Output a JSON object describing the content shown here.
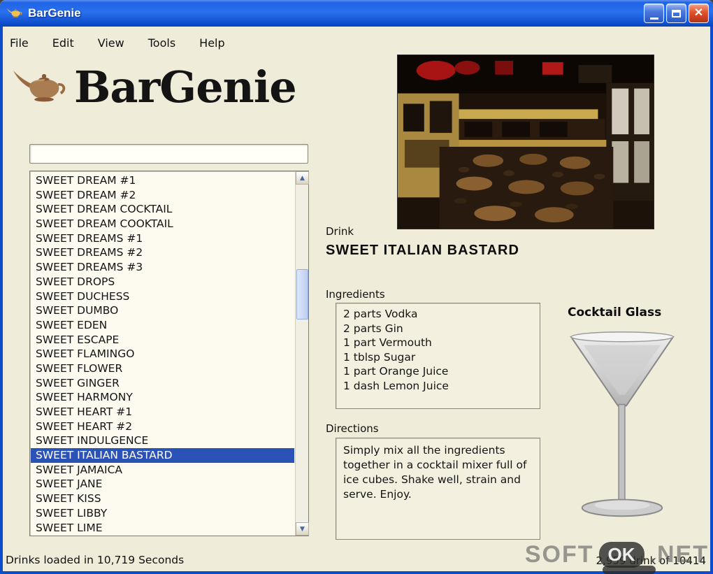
{
  "window": {
    "title": "BarGenie"
  },
  "menu": {
    "items": [
      "File",
      "Edit",
      "View",
      "Tools",
      "Help"
    ]
  },
  "logo": {
    "text": "BarGenie"
  },
  "search": {
    "value": ""
  },
  "drink_list": {
    "items": [
      "SWEET DREAM #1",
      "SWEET DREAM #2",
      "SWEET DREAM COCKTAIL",
      "SWEET DREAM COOKTAIL",
      "SWEET DREAMS #1",
      "SWEET DREAMS #2",
      "SWEET DREAMS #3",
      "SWEET DROPS",
      "SWEET DUCHESS",
      "SWEET DUMBO",
      "SWEET EDEN",
      "SWEET ESCAPE",
      "SWEET FLAMINGO",
      "SWEET FLOWER",
      "SWEET GINGER",
      "SWEET HARMONY",
      "SWEET HEART #1",
      "SWEET HEART #2",
      "SWEET INDULGENCE",
      "SWEET ITALIAN BASTARD",
      "SWEET JAMAICA",
      "SWEET JANE",
      "SWEET KISS",
      "SWEET LIBBY",
      "SWEET LIME"
    ],
    "selected": "SWEET ITALIAN BASTARD"
  },
  "detail": {
    "drink_label": "Drink",
    "drink_name": "SWEET ITALIAN BASTARD",
    "ingredients_label": "Ingredients",
    "ingredients": [
      "2 parts Vodka",
      "2 parts Gin",
      "1 part Vermouth",
      "1 tblsp Sugar",
      "1 part Orange Juice",
      "1 dash Lemon Juice"
    ],
    "glass_label": "Cocktail Glass",
    "directions_label": "Directions",
    "directions": "Simply mix all the ingredients together in a cocktail mixer full of ice cubes.  Shake well, strain and serve.  Enjoy."
  },
  "status": {
    "left": "Drinks loaded in 10,719 Seconds",
    "right": "2,959 drink of 10414"
  },
  "watermark": {
    "prefix": "SOFT",
    "badge": "OK",
    "suffix": ".NET"
  },
  "colors": {
    "titlebar_blue": "#1f63e6",
    "selection_blue": "#2b53b7",
    "background_cream": "#efecd9",
    "close_red": "#d8441f"
  }
}
